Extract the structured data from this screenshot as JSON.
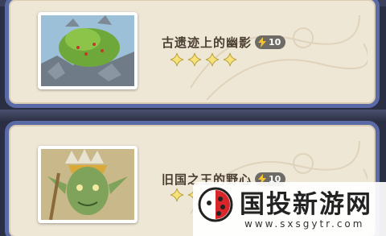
{
  "quests": [
    {
      "title": "古遗迹上的幽影",
      "energy_cost": "10",
      "star_count": 4,
      "thumbnail_icon": "mossy-ruins-creature-icon"
    },
    {
      "title": "旧国之王的野心",
      "energy_cost": "10",
      "star_count": 2,
      "thumbnail_icon": "goblin-king-icon"
    }
  ],
  "watermark": {
    "title": "国投新游网",
    "url": "www.sxsgytr.com",
    "logo_icon": "ladybug-logo-icon"
  },
  "colors": {
    "card_bg": "#efe7d6",
    "card_border": "#5a6aa6",
    "title_text": "#4b3f33",
    "badge_bg": "#6e6a66",
    "bolt": "#f2c530",
    "star": "#f7e27a"
  }
}
